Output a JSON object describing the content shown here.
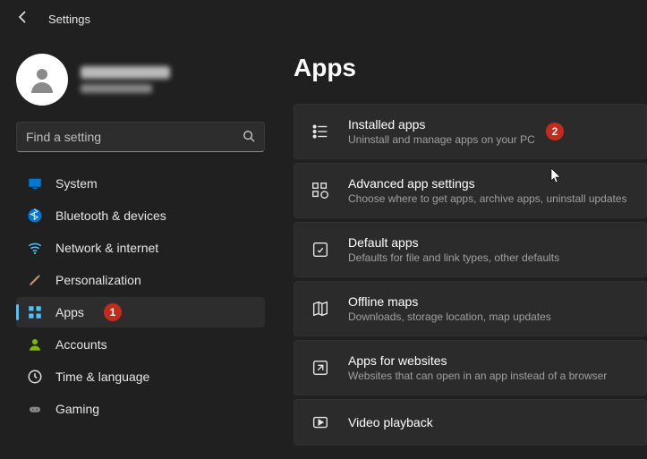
{
  "top": {
    "title": "Settings"
  },
  "search": {
    "placeholder": "Find a setting"
  },
  "sidebar": {
    "items": [
      {
        "label": "System"
      },
      {
        "label": "Bluetooth & devices"
      },
      {
        "label": "Network & internet"
      },
      {
        "label": "Personalization"
      },
      {
        "label": "Apps",
        "badge": "1"
      },
      {
        "label": "Accounts"
      },
      {
        "label": "Time & language"
      },
      {
        "label": "Gaming"
      }
    ]
  },
  "page": {
    "title": "Apps",
    "cards": [
      {
        "title": "Installed apps",
        "sub": "Uninstall and manage apps on your PC",
        "badge": "2"
      },
      {
        "title": "Advanced app settings",
        "sub": "Choose where to get apps, archive apps, uninstall updates"
      },
      {
        "title": "Default apps",
        "sub": "Defaults for file and link types, other defaults"
      },
      {
        "title": "Offline maps",
        "sub": "Downloads, storage location, map updates"
      },
      {
        "title": "Apps for websites",
        "sub": "Websites that can open in an app instead of a browser"
      },
      {
        "title": "Video playback"
      }
    ]
  }
}
